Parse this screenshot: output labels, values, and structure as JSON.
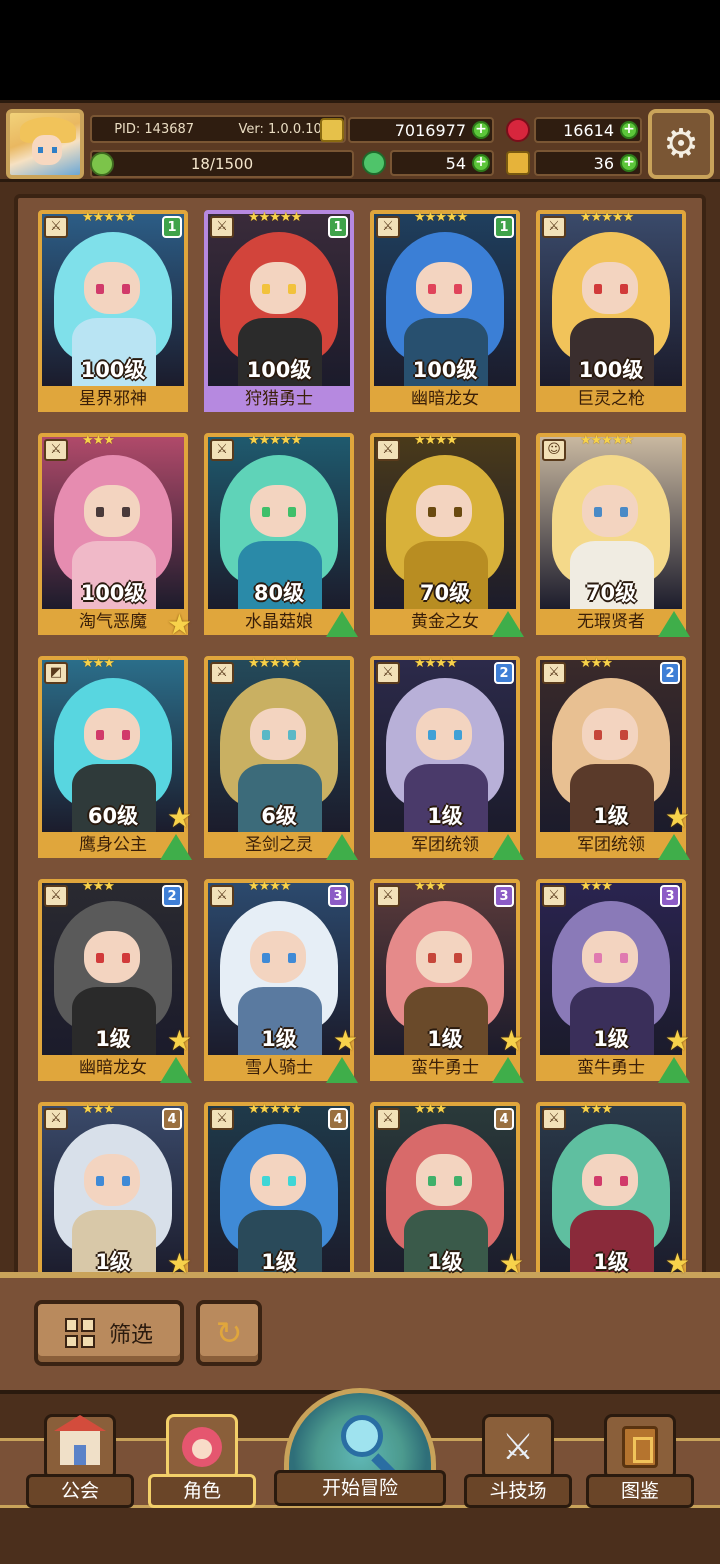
{
  "header": {
    "pid": "PID: 143687",
    "version": "Ver: 1.0.0.10",
    "exp": "18/1500",
    "exp_progress": 0.012,
    "resources": [
      {
        "name": "gold",
        "icon": "gold-coin-icon",
        "amount": "7016977",
        "color": "#e6c14a"
      },
      {
        "name": "ruby",
        "icon": "ruby-icon",
        "amount": "16614",
        "color": "#d7263d"
      },
      {
        "name": "clover",
        "icon": "clover-icon",
        "amount": "54",
        "color": "#4fc46a"
      },
      {
        "name": "key",
        "icon": "key-icon",
        "amount": "36",
        "color": "#e6b33a"
      }
    ]
  },
  "heroes": [
    {
      "name": "星界邪神",
      "level": "100级",
      "stars": "★★★★★",
      "badge": "1",
      "badge_color": "green",
      "type_icon": "sword-icon",
      "hair": "#7fe0ea",
      "body": "#b9e4f3",
      "eye": "#d13a6a",
      "bg": "#2c5d86",
      "frame": "gold",
      "upgrade": "",
      "purple": false
    },
    {
      "name": "狩猎勇士",
      "level": "100级",
      "stars": "★★★★★",
      "badge": "1",
      "badge_color": "green",
      "type_icon": "sword-icon",
      "hair": "#d2443b",
      "body": "#2b2b2b",
      "eye": "#f2c23c",
      "bg": "#3a2b3a",
      "frame": "purple",
      "upgrade": "",
      "purple": true
    },
    {
      "name": "幽暗龙女",
      "level": "100级",
      "stars": "★★★★★",
      "badge": "1",
      "badge_color": "green",
      "type_icon": "sword-icon",
      "hair": "#3b7fd6",
      "body": "#28506f",
      "eye": "#e0445a",
      "bg": "#1f3f5e",
      "frame": "gold",
      "upgrade": "",
      "purple": false
    },
    {
      "name": "巨灵之枪",
      "level": "100级",
      "stars": "★★★★★",
      "badge": "",
      "badge_color": "",
      "type_icon": "sword-icon",
      "hair": "#f1c35a",
      "body": "#3a2e2e",
      "eye": "#d13a3a",
      "bg": "#3a4a6a",
      "frame": "gold",
      "upgrade": "",
      "purple": false
    },
    {
      "name": "淘气恶魔",
      "level": "100级",
      "stars": "★★★",
      "badge": "",
      "badge_color": "",
      "type_icon": "sword-icon",
      "hair": "#e68cb0",
      "body": "#f0b9c8",
      "eye": "#4a3a3a",
      "bg": "#b04a6a",
      "frame": "gold",
      "upgrade": "star",
      "purple": false
    },
    {
      "name": "水晶菇娘",
      "level": "80级",
      "stars": "★★★★★",
      "badge": "",
      "badge_color": "",
      "type_icon": "sword-icon",
      "hair": "#5fd3b8",
      "body": "#2a8aa8",
      "eye": "#3fbf6a",
      "bg": "#1f5a6e",
      "frame": "gold",
      "upgrade": "arrow",
      "purple": false
    },
    {
      "name": "黄金之女",
      "level": "70级",
      "stars": "★★★★",
      "badge": "",
      "badge_color": "",
      "type_icon": "sword-icon",
      "hair": "#d8b13a",
      "body": "#b88d22",
      "eye": "#6a4a10",
      "bg": "#4a3a1a",
      "frame": "gold",
      "upgrade": "arrow",
      "purple": false
    },
    {
      "name": "无瑕贤者",
      "level": "70级",
      "stars": "★★★★★",
      "badge": "",
      "badge_color": "",
      "type_icon": "mask-icon",
      "hair": "#f4d98a",
      "body": "#f0ece2",
      "eye": "#4a8ac6",
      "bg": "#c9b8a0",
      "frame": "gold",
      "upgrade": "arrow",
      "purple": false
    },
    {
      "name": "鹰身公主",
      "level": "60级",
      "stars": "★★★",
      "badge": "",
      "badge_color": "",
      "type_icon": "bow-icon",
      "hair": "#58d6e0",
      "body": "#2f3a3a",
      "eye": "#d13a6a",
      "bg": "#2b6e8a",
      "frame": "gold",
      "upgrade": "both",
      "purple": false
    },
    {
      "name": "圣剑之灵",
      "level": "6级",
      "stars": "★★★★★",
      "badge": "",
      "badge_color": "",
      "type_icon": "sword-icon",
      "hair": "#c9b062",
      "body": "#3c6b7a",
      "eye": "#5ab8c6",
      "bg": "#244a5a",
      "frame": "gold",
      "upgrade": "arrow",
      "purple": false
    },
    {
      "name": "军团统领",
      "level": "1级",
      "stars": "★★★★",
      "badge": "2",
      "badge_color": "blue",
      "type_icon": "sword-icon",
      "hair": "#b8b0d8",
      "body": "#4a3a6a",
      "eye": "#3fa0d6",
      "bg": "#2c2a4a",
      "frame": "gold",
      "upgrade": "arrow",
      "purple": false
    },
    {
      "name": "军团统领",
      "level": "1级",
      "stars": "★★★",
      "badge": "2",
      "badge_color": "blue",
      "type_icon": "sword-icon",
      "hair": "#e8c092",
      "body": "#5a3a2a",
      "eye": "#c6463a",
      "bg": "#3a2a2a",
      "frame": "gold",
      "upgrade": "both",
      "purple": false
    },
    {
      "name": "幽暗龙女",
      "level": "1级",
      "stars": "★★★",
      "badge": "2",
      "badge_color": "blue",
      "type_icon": "sword-icon",
      "hair": "#5a5a5a",
      "body": "#2a2a2a",
      "eye": "#d13a3a",
      "bg": "#2a2a30",
      "frame": "gold",
      "upgrade": "both",
      "purple": false
    },
    {
      "name": "雪人骑士",
      "level": "1级",
      "stars": "★★★★",
      "badge": "3",
      "badge_color": "purple",
      "type_icon": "sword-icon",
      "hair": "#e6eef6",
      "body": "#5a7aa0",
      "eye": "#3f8ad6",
      "bg": "#2c4a6e",
      "frame": "gold",
      "upgrade": "both",
      "purple": false
    },
    {
      "name": "蛮牛勇士",
      "level": "1级",
      "stars": "★★★",
      "badge": "3",
      "badge_color": "purple",
      "type_icon": "sword-icon",
      "hair": "#e58a8a",
      "body": "#6a4a2a",
      "eye": "#c6463a",
      "bg": "#5a3a3a",
      "frame": "gold",
      "upgrade": "both",
      "purple": false
    },
    {
      "name": "蛮牛勇士",
      "level": "1级",
      "stars": "★★★",
      "badge": "3",
      "badge_color": "purple",
      "type_icon": "sword-icon",
      "hair": "#8a7ab8",
      "body": "#3a2f5a",
      "eye": "#e07ab0",
      "bg": "#2a2450",
      "frame": "gold",
      "upgrade": "both",
      "purple": false
    },
    {
      "name": "",
      "level": "1级",
      "stars": "★★★",
      "badge": "4",
      "badge_color": "brown",
      "type_icon": "sword-icon",
      "hair": "#d8e0ea",
      "body": "#d8c8a8",
      "eye": "#3f8ad6",
      "bg": "#3a4a6a",
      "frame": "gold",
      "upgrade": "star",
      "purple": false
    },
    {
      "name": "",
      "level": "1级",
      "stars": "★★★★★",
      "badge": "4",
      "badge_color": "brown",
      "type_icon": "sword-icon",
      "hair": "#3f8ad6",
      "body": "#2a4a5a",
      "eye": "#3fd6d6",
      "bg": "#1f3a4a",
      "frame": "gold",
      "upgrade": "",
      "purple": false
    },
    {
      "name": "",
      "level": "1级",
      "stars": "★★★",
      "badge": "4",
      "badge_color": "brown",
      "type_icon": "sword-icon",
      "hair": "#d86a6a",
      "body": "#3a5a4a",
      "eye": "#3fb06a",
      "bg": "#2a3a3a",
      "frame": "gold",
      "upgrade": "star",
      "purple": false
    },
    {
      "name": "",
      "level": "1级",
      "stars": "★★★",
      "badge": "",
      "badge_color": "",
      "type_icon": "sword-icon",
      "hair": "#5fbfa0",
      "body": "#8a2a3a",
      "eye": "#d13a6a",
      "bg": "#2a3a4a",
      "frame": "gold",
      "upgrade": "star",
      "purple": false
    }
  ],
  "filter": {
    "label": "筛选",
    "grid_icon": "grid-icon",
    "sort_icon": "refresh-icon"
  },
  "nav": {
    "guild": "公会",
    "character": "角色",
    "adventure": "开始冒险",
    "arena": "斗技场",
    "codex": "图鉴"
  },
  "colors": {
    "gold_frame": "#e0a63c",
    "purple_frame": "#b689e0",
    "panel": "#7a5137",
    "accent_green": "#5cc63a"
  }
}
